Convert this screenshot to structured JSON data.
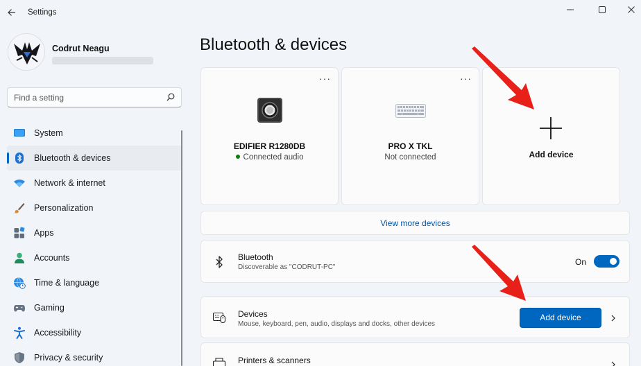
{
  "window": {
    "title": "Settings",
    "back_glyph": "←",
    "minimize_glyph": "—",
    "maximize_glyph": "☐",
    "close_glyph": "✕"
  },
  "profile": {
    "name": "Codrut Neagu",
    "avatar_icon": "bat-avatar-icon"
  },
  "search": {
    "placeholder": "Find a setting",
    "value": ""
  },
  "sidebar": {
    "items": [
      {
        "label": "System",
        "icon": "monitor-icon",
        "active": false
      },
      {
        "label": "Bluetooth & devices",
        "icon": "bluetooth-icon",
        "active": true
      },
      {
        "label": "Network & internet",
        "icon": "wifi-icon",
        "active": false
      },
      {
        "label": "Personalization",
        "icon": "brush-icon",
        "active": false
      },
      {
        "label": "Apps",
        "icon": "apps-icon",
        "active": false
      },
      {
        "label": "Accounts",
        "icon": "person-icon",
        "active": false
      },
      {
        "label": "Time & language",
        "icon": "globe-clock-icon",
        "active": false
      },
      {
        "label": "Gaming",
        "icon": "gamepad-icon",
        "active": false
      },
      {
        "label": "Accessibility",
        "icon": "accessibility-icon",
        "active": false
      },
      {
        "label": "Privacy & security",
        "icon": "shield-icon",
        "active": false
      }
    ]
  },
  "main": {
    "title": "Bluetooth & devices",
    "more_glyph": "···",
    "devices": [
      {
        "name": "EDIFIER R1280DB",
        "status": "Connected audio",
        "connected": true,
        "icon": "speaker-icon"
      },
      {
        "name": "PRO X TKL",
        "status": "Not connected",
        "connected": false,
        "icon": "keyboard-icon"
      }
    ],
    "add_card_label": "Add device",
    "view_more": "View more devices",
    "bluetooth": {
      "title": "Bluetooth",
      "subtitle": "Discoverable as \"CODRUT-PC\"",
      "toggle_label": "On",
      "enabled": true
    },
    "devices_row": {
      "title": "Devices",
      "subtitle": "Mouse, keyboard, pen, audio, displays and docks, other devices",
      "button_label": "Add device"
    },
    "printers_row": {
      "title": "Printers & scanners"
    }
  },
  "colors": {
    "accent": "#0067c0",
    "background": "#f1f4f9",
    "card": "#fbfbfc",
    "annotation_arrow": "#e8201a",
    "connected_dot": "#0f7b0f"
  }
}
